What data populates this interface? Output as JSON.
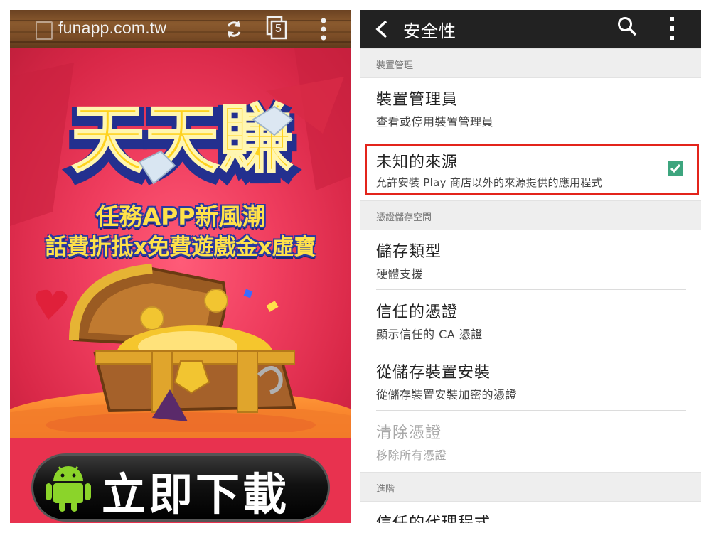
{
  "browser": {
    "url": "funapp.com.tw",
    "tab_count": "5",
    "icons": [
      "page-icon",
      "refresh-icon",
      "tabs-icon",
      "overflow-menu-icon"
    ]
  },
  "ad": {
    "headline": "天天賺",
    "tagline_1": "任務APP新風潮",
    "tagline_2": "話費折抵x免費遊戲金x虛寶",
    "download_button": "立即下載",
    "colors": {
      "background": "#e8324f",
      "headline": "#ffd21e",
      "tagline": "#ffe14a",
      "button": "#111111"
    }
  },
  "settings": {
    "title": "安全性",
    "icons": [
      "back-icon",
      "search-icon",
      "overflow-menu-icon",
      "checkbox-checked-icon"
    ],
    "sections": [
      {
        "header": "裝置管理"
      },
      {
        "header": "憑證儲存空間"
      },
      {
        "header": "進階"
      }
    ],
    "items": [
      {
        "title": "裝置管理員",
        "summary": "查看或停用裝置管理員"
      },
      {
        "title": "未知的來源",
        "summary": "允許安裝 Play 商店以外的來源提供的應用程式",
        "checked": true
      },
      {
        "title": "儲存類型",
        "summary": "硬體支援"
      },
      {
        "title": "信任的憑證",
        "summary": "顯示信任的 CA 憑證"
      },
      {
        "title": "從儲存裝置安裝",
        "summary": "從儲存裝置安裝加密的憑證"
      },
      {
        "title": "清除憑證",
        "summary": "移除所有憑證",
        "disabled": true
      },
      {
        "title": "信任的代理程式"
      }
    ],
    "colors": {
      "action_bar": "#222222",
      "highlight": "#e3241b",
      "checkbox": "#3da57e"
    }
  }
}
